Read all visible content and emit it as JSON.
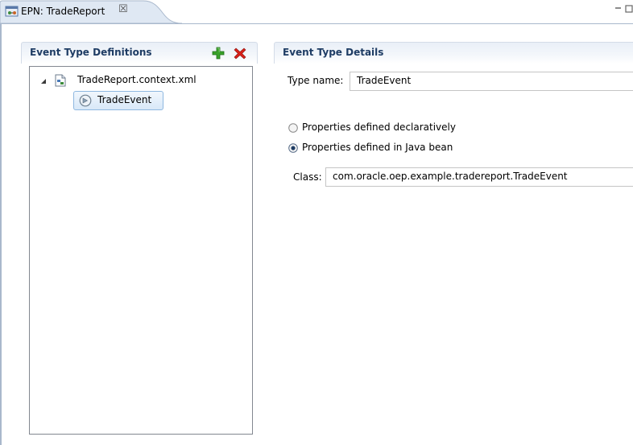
{
  "editor": {
    "tab_title": "EPN: TradeReport",
    "close_glyph": "☒"
  },
  "left_panel": {
    "title": "Event Type Definitions",
    "add_icon": "plus-icon",
    "delete_icon": "x-icon",
    "tree": {
      "root_label": "TradeReport.context.xml",
      "root_expanded": true,
      "child_label": "TradeEvent",
      "child_selected": true
    }
  },
  "right_panel": {
    "title": "Event Type Details",
    "type_name_label": "Type name:",
    "type_name_value": "TradeEvent",
    "radio_declarative_label": "Properties defined declaratively",
    "radio_java_bean_label": "Properties defined in Java bean",
    "selected_radio": "java_bean",
    "class_label": "Class:",
    "class_value": "com.oracle.oep.example.tradereport.TradeEvent"
  },
  "colors": {
    "section_title": "#1e3c64",
    "accent_border": "#a9b8cc",
    "add_green": "#3aa22a",
    "delete_red": "#d8211a"
  }
}
